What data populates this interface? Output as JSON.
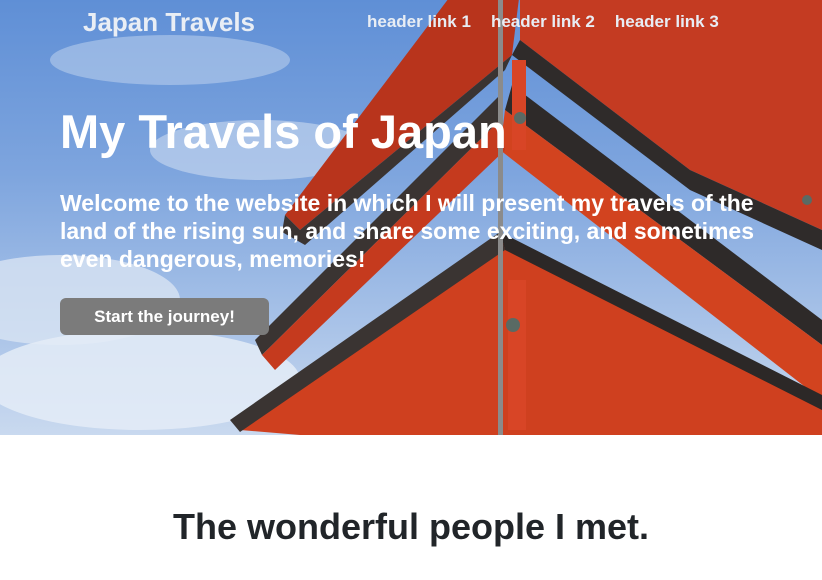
{
  "header": {
    "brand": "Japan Travels",
    "links": [
      "header link 1",
      "header link 2",
      "header link 3"
    ]
  },
  "hero": {
    "title": "My Travels of Japan",
    "text": "Welcome to the website in which I will present my travels of the land of the rising sun, and share some exciting, and sometimes even dangerous, memories!",
    "button_label": "Start the journey!"
  },
  "section": {
    "title": "The wonderful people I met."
  },
  "colors": {
    "pagoda_red": "#cc3a1f",
    "roof_dark": "#3a3432",
    "sky": "#7ea5de",
    "button_gray": "#7b7b7b"
  }
}
